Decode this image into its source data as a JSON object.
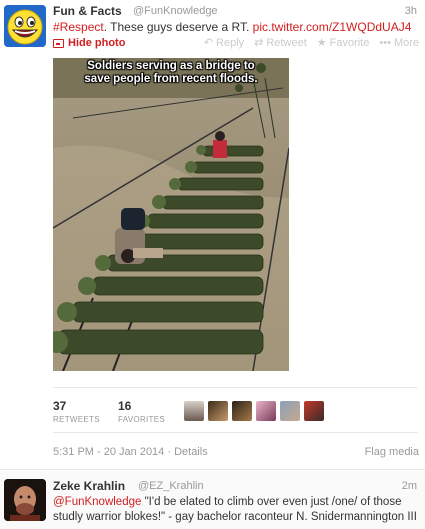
{
  "tweet": {
    "fullname": "Fun & Facts",
    "username": "@FunKnowledge",
    "time": "3h",
    "hashtag": "#Respect",
    "text": ". These guys deserve a RT. ",
    "link": "pic.twitter.com/Z1WQDdUAJ4",
    "hide_photo": "Hide photo",
    "actions": {
      "reply": "Reply",
      "retweet": "Retweet",
      "favorite": "Favorite",
      "more": "More"
    },
    "photo_caption_line1": "Soldiers serving as a bridge to",
    "photo_caption_line2": "save people from recent floods.",
    "retweets_count": "37",
    "retweets_label": "RETWEETS",
    "favorites_count": "16",
    "favorites_label": "FAVORITES",
    "timestamp": "5:31 PM - 20 Jan 2014 · Details",
    "flag_media": "Flag media"
  },
  "reply": {
    "fullname": "Zeke Krahlin",
    "username": "@EZ_Krahlin",
    "time": "2m",
    "mention": "@FunKnowledge",
    "text": " \"I'd be elated to climb over even just /one/ of those studly warrior blokes!\" - gay bachelor raconteur N. Snidermannington III"
  },
  "colors": {
    "accent": "#d21e1e",
    "muted": "#999999",
    "text": "#333333"
  },
  "icons": [
    "trollface-icon",
    "hide-photo-icon",
    "reply-icon",
    "retweet-icon",
    "favorite-icon",
    "more-icon"
  ]
}
